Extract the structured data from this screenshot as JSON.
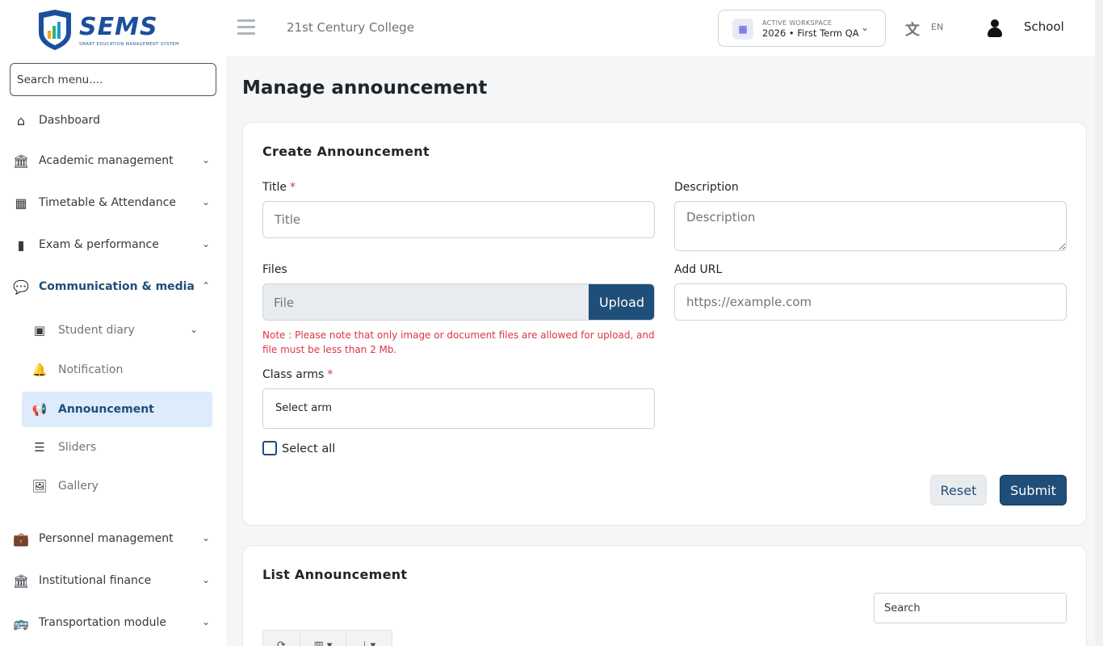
{
  "header": {
    "logo_text": "SEMS",
    "logo_subtitle": "SMART EDUCATION MANAGEMENT SYSTEM",
    "college_name": "21st Century College",
    "workspace_label": "ACTIVE WORKSPACE",
    "workspace_value": "2026 • First Term QA",
    "language": "EN",
    "user_name": "School"
  },
  "sidebar": {
    "search_placeholder": "Search menu....",
    "items": [
      {
        "label": "Dashboard",
        "icon": "home-icon"
      },
      {
        "label": "Academic management",
        "icon": "institution-icon"
      },
      {
        "label": "Timetable & Attendance",
        "icon": "calendar-icon"
      },
      {
        "label": "Exam & performance",
        "icon": "book-icon"
      },
      {
        "label": "Communication & media",
        "icon": "comments-icon"
      },
      {
        "label": "Personnel management",
        "icon": "briefcase-icon"
      },
      {
        "label": "Institutional finance",
        "icon": "institution-icon"
      },
      {
        "label": "Transportation module",
        "icon": "bus-icon"
      }
    ],
    "sub_items": [
      {
        "label": "Student diary",
        "icon": "inbox-icon"
      },
      {
        "label": "Notification",
        "icon": "bell-icon"
      },
      {
        "label": "Announcement",
        "icon": "bullhorn-icon"
      },
      {
        "label": "Sliders",
        "icon": "list-icon"
      },
      {
        "label": "Gallery",
        "icon": "images-icon"
      }
    ]
  },
  "main": {
    "page_title": "Manage announcement",
    "create": {
      "title": "Create Announcement",
      "title_label": "Title",
      "title_required": "*",
      "title_placeholder": "Title",
      "description_label": "Description",
      "description_placeholder": "Description",
      "files_label": "Files",
      "file_placeholder": "File",
      "upload_label": "Upload",
      "note": "Note : Please note that only image or document files are allowed for upload, and file must be less than 2 Mb.",
      "url_label": "Add URL",
      "url_placeholder": "https://example.com",
      "class_arms_label": "Class arms",
      "class_arms_required": "*",
      "select_placeholder": "Select arm",
      "select_all_label": "Select all",
      "reset_label": "Reset",
      "submit_label": "Submit"
    },
    "list": {
      "title": "List Announcement",
      "search_placeholder": "Search"
    }
  },
  "colors": {
    "primary": "#1f4e79",
    "active_bg": "#ddebfb",
    "danger": "#dc3545"
  }
}
